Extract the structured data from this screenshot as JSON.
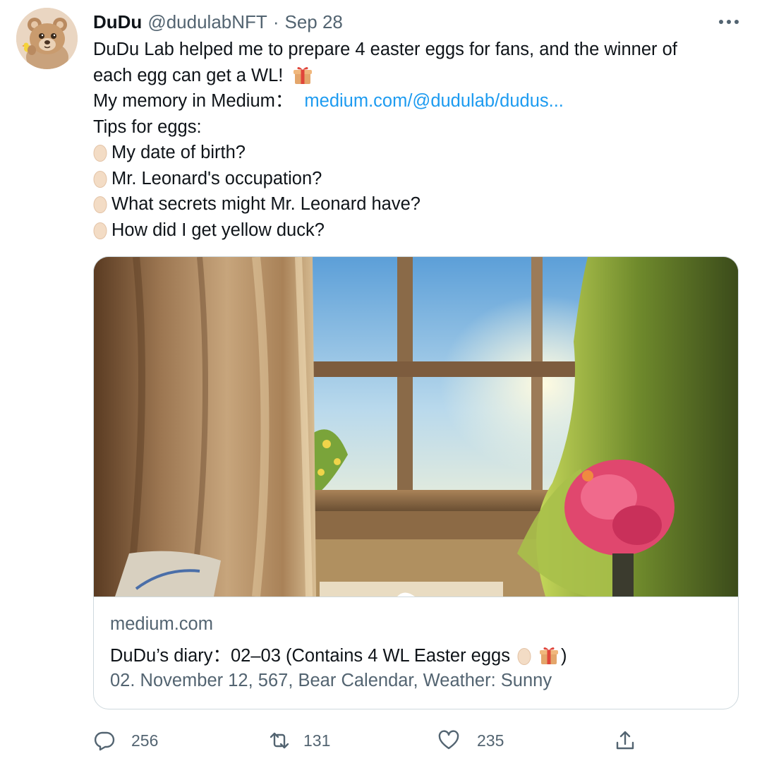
{
  "tweet": {
    "author": {
      "display_name": "DuDu",
      "handle": "@dudulabNFT",
      "separator": "·",
      "date": "Sep 28",
      "avatar_icon": "bear-avatar"
    },
    "more_icon": "more-horizontal-icon",
    "text": {
      "line1": "DuDu Lab helped me to prepare 4 easter eggs for fans, and the winner of",
      "line2": "each egg can get a WL!",
      "line3_prefix": "My memory in Medium：",
      "line3_link": "medium.com/@dudulab/dudus...",
      "line4": "Tips for eggs:",
      "tips": [
        "My date of birth?",
        "Mr. Leonard's occupation?",
        "What secrets might Mr. Leonard have?",
        "How did I get yellow duck?"
      ]
    },
    "link_card": {
      "domain": "medium.com",
      "title_prefix": "DuDu’s diary：02–03 (Contains 4 WL Easter eggs",
      "title_suffix": ")",
      "description": "02. November 12, 567, Bear Calendar, Weather: Sunny",
      "image_description_icon": "painting-window-flowers-image"
    },
    "actions": {
      "reply": {
        "icon": "reply-icon",
        "count": "256"
      },
      "retweet": {
        "icon": "retweet-icon",
        "count": "131"
      },
      "like": {
        "icon": "heart-icon",
        "count": "235"
      },
      "share": {
        "icon": "share-icon"
      }
    },
    "colors": {
      "text": "#0f1419",
      "secondary": "#536471",
      "link": "#1d9bf0",
      "border": "#cfd9de"
    }
  }
}
